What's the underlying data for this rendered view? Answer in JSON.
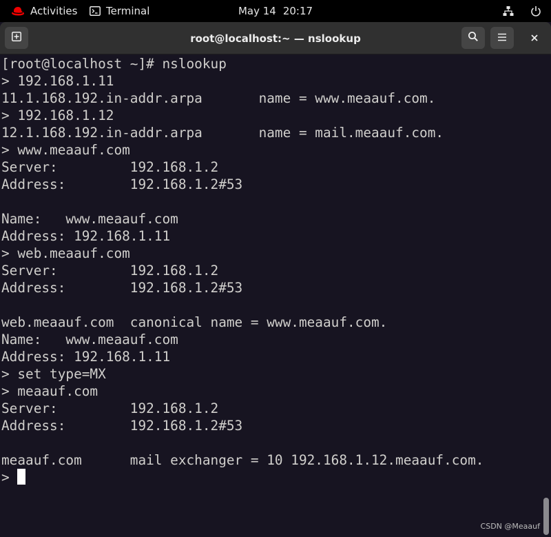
{
  "topbar": {
    "activities_label": "Activities",
    "app_label": "Terminal",
    "date": "May 14",
    "time": "20:17",
    "icons": [
      "redhat-logo-icon",
      "terminal-icon",
      "network-icon",
      "power-icon"
    ]
  },
  "window": {
    "title": "root@localhost:~ — nslookup",
    "icons": [
      "new-tab-icon",
      "search-icon",
      "menu-icon",
      "close-icon"
    ]
  },
  "terminal": {
    "lines": [
      "[root@localhost ~]# nslookup",
      "> 192.168.1.11",
      "11.1.168.192.in-addr.arpa       name = www.meaauf.com.",
      "> 192.168.1.12",
      "12.1.168.192.in-addr.arpa       name = mail.meaauf.com.",
      "> www.meaauf.com",
      "Server:         192.168.1.2",
      "Address:        192.168.1.2#53",
      "",
      "Name:   www.meaauf.com",
      "Address: 192.168.1.11",
      "> web.meaauf.com",
      "Server:         192.168.1.2",
      "Address:        192.168.1.2#53",
      "",
      "web.meaauf.com  canonical name = www.meaauf.com.",
      "Name:   www.meaauf.com",
      "Address: 192.168.1.11",
      "> set type=MX",
      "> meaauf.com",
      "Server:         192.168.1.2",
      "Address:        192.168.1.2#53",
      "",
      "meaauf.com      mail exchanger = 10 192.168.1.12.meaauf.com."
    ],
    "prompt": "> ",
    "foreground_color": "#d0cfcc",
    "background_color": "#171421"
  },
  "watermark": "CSDN @Meaauf",
  "colors": {
    "topbar_bg": "#000000",
    "headerbar_bg": "#303030",
    "redhat_red": "#ee0000"
  }
}
